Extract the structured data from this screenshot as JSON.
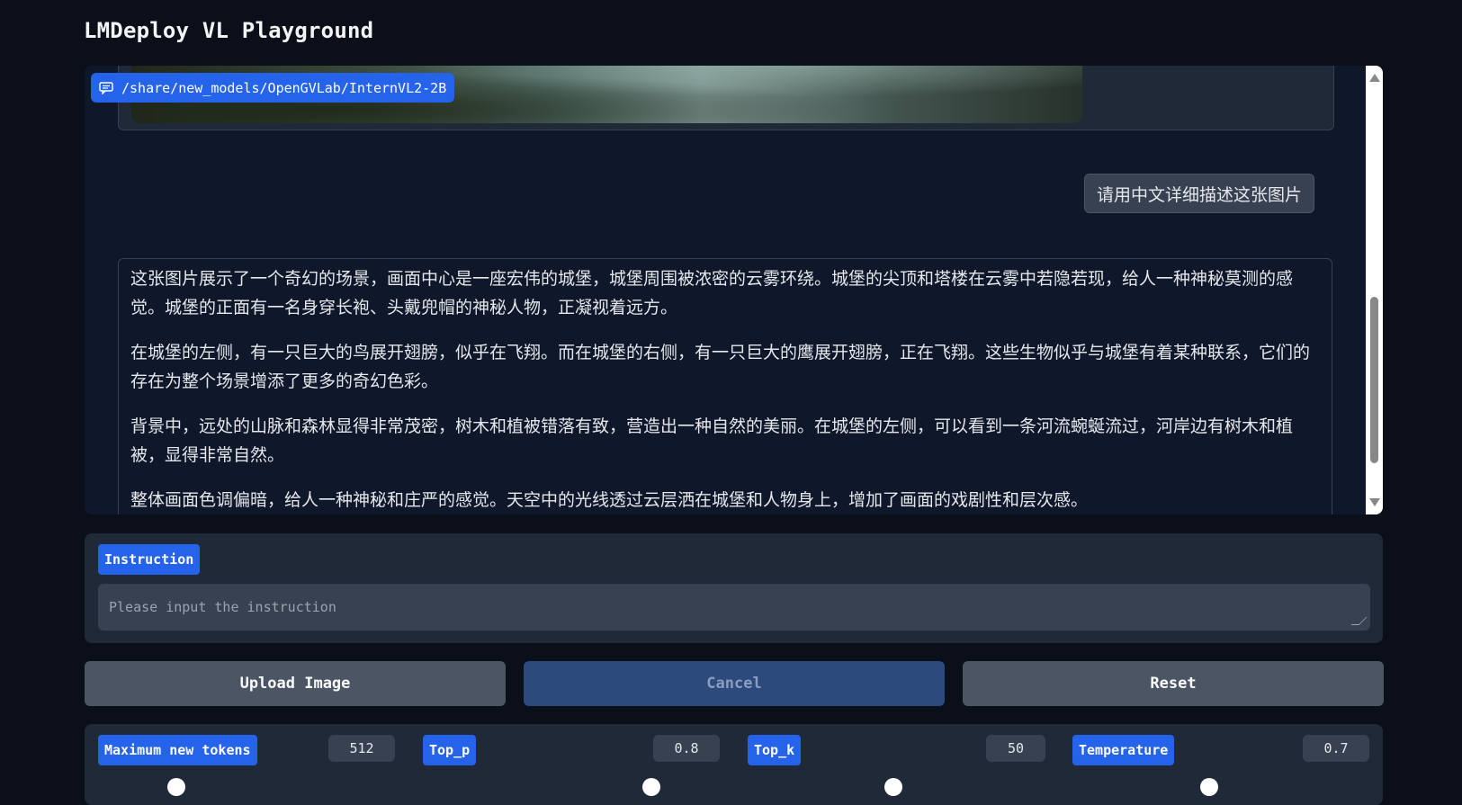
{
  "app": {
    "title": "LMDeploy VL Playground"
  },
  "chat": {
    "model_label": "/share/new_models/OpenGVLab/InternVL2-2B",
    "user_message": "请用中文详细描述这张图片",
    "assistant_paragraphs": [
      "这张图片展示了一个奇幻的场景，画面中心是一座宏伟的城堡，城堡周围被浓密的云雾环绕。城堡的尖顶和塔楼在云雾中若隐若现，给人一种神秘莫测的感觉。城堡的正面有一名身穿长袍、头戴兜帽的神秘人物，正凝视着远方。",
      "在城堡的左侧，有一只巨大的鸟展开翅膀，似乎在飞翔。而在城堡的右侧，有一只巨大的鹰展开翅膀，正在飞翔。这些生物似乎与城堡有着某种联系，它们的存在为整个场景增添了更多的奇幻色彩。",
      "背景中，远处的山脉和森林显得非常茂密，树木和植被错落有致，营造出一种自然的美丽。在城堡的左侧，可以看到一条河流蜿蜒流过，河岸边有树木和植被，显得非常自然。",
      "整体画面色调偏暗，给人一种神秘和庄严的感觉。天空中的光线透过云层洒在城堡和人物身上，增加了画面的戏剧性和层次感。"
    ]
  },
  "instruction": {
    "label": "Instruction",
    "placeholder": "Please input the instruction",
    "value": ""
  },
  "buttons": {
    "upload": "Upload Image",
    "cancel": "Cancel",
    "reset": "Reset"
  },
  "params": {
    "max_new_tokens": {
      "label": "Maximum new tokens",
      "value": "512"
    },
    "top_p": {
      "label": "Top_p",
      "value": "0.8"
    },
    "top_k": {
      "label": "Top_k",
      "value": "50"
    },
    "temperature": {
      "label": "Temperature",
      "value": "0.7"
    }
  },
  "colors": {
    "background": "#0b0f19",
    "accent": "#2563eb",
    "panel": "#1f2937",
    "button": "#4b5563"
  }
}
